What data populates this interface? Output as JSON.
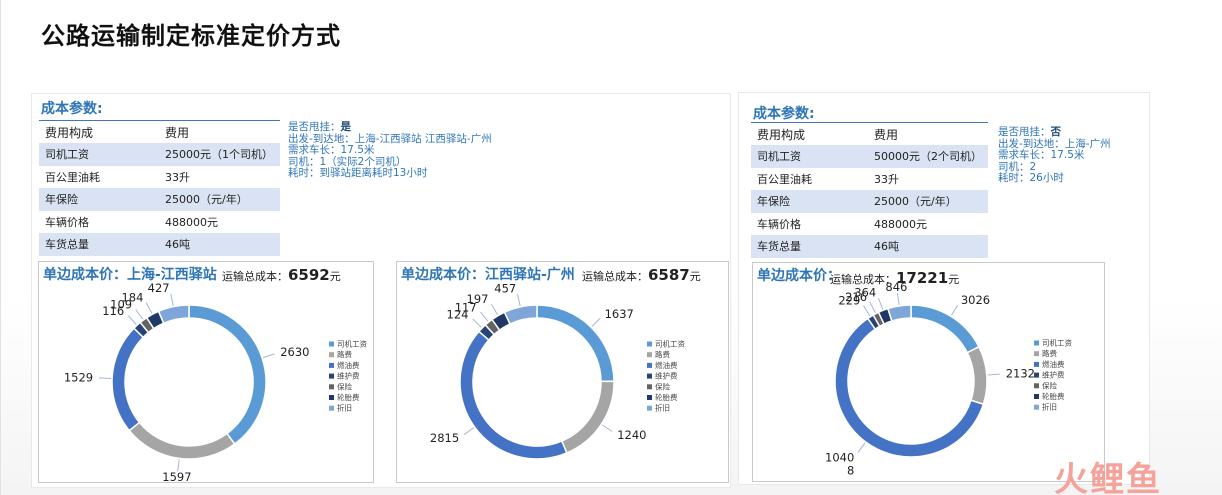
{
  "page": {
    "title": "公路运输制定标准定价方式"
  },
  "left": {
    "section_title": "成本参数:",
    "table_header": [
      "费用构成",
      "费用"
    ],
    "rows": [
      [
        "司机工资",
        "25000元（1个司机）"
      ],
      [
        "百公里油耗",
        "33升"
      ],
      [
        "年保险",
        "25000（元/年）"
      ],
      [
        "车辆价格",
        "488000元"
      ],
      [
        "车货总量",
        "46吨"
      ]
    ],
    "notes": {
      "relay_label": "是否甩挂：",
      "relay_value": "是",
      "line2": "出发-到达地：上海-江西驿站   江西驿站-广州",
      "line3": "需求车长：17.5米",
      "line4": "司机：1（实际2个司机）",
      "line5": "耗时：到驿站距离耗时13小时"
    }
  },
  "right": {
    "section_title": "成本参数:",
    "table_header": [
      "费用构成",
      "费用"
    ],
    "rows": [
      [
        "司机工资",
        "50000元（2个司机）"
      ],
      [
        "百公里油耗",
        "33升"
      ],
      [
        "年保险",
        "25000（元/年）"
      ],
      [
        "车辆价格",
        "488000元"
      ],
      [
        "车货总量",
        "46吨"
      ]
    ],
    "notes": {
      "relay_label": "是否甩挂：",
      "relay_value": "否",
      "line2": "出发-到达地：上海-广州",
      "line3": "需求车长：17.5米",
      "line4": "司机：2",
      "line5": "耗时：26小时"
    }
  },
  "chart_data": [
    {
      "type": "pie",
      "title": "单边成本价：上海-江西驿站",
      "total_label": "运输总成本：",
      "total_value": "6592",
      "total_unit": "元",
      "categories": [
        "司机工资",
        "路费",
        "燃油费",
        "维护费",
        "保险",
        "轮胎费",
        "折旧"
      ],
      "values": [
        2630,
        1597,
        1529,
        116,
        109,
        184,
        427
      ],
      "value_labels": [
        "2630",
        "1597",
        "1529",
        "116",
        "109",
        "184",
        "427"
      ],
      "legend_position": "right"
    },
    {
      "type": "pie",
      "title": "单边成本价：江西驿站-广州",
      "total_label": "运输总成本：",
      "total_value": "6587",
      "total_unit": "元",
      "categories": [
        "司机工资",
        "路费",
        "燃油费",
        "维护费",
        "保险",
        "轮胎费",
        "折旧"
      ],
      "values": [
        1637,
        1240,
        2815,
        124,
        117,
        197,
        457
      ],
      "value_labels": [
        "1637",
        "1240",
        "2815",
        "124",
        "117",
        "197",
        "457"
      ],
      "legend_position": "right"
    },
    {
      "type": "pie",
      "title": "单边成本价：",
      "total_label": "运输总成本：",
      "total_value": "17221",
      "total_unit": "元",
      "categories": [
        "司机工资",
        "路费",
        "燃油费",
        "维护费",
        "保险",
        "轮胎费",
        "折旧"
      ],
      "values": [
        3026,
        2132,
        10408,
        229,
        216,
        364,
        846
      ],
      "value_labels": [
        "3026",
        "2132",
        "1040\n8",
        "229",
        "216",
        "364",
        "846"
      ],
      "legend_position": "right"
    }
  ],
  "colors": {
    "series": [
      "#5b9bd5",
      "#a5a5a5",
      "#4472c4",
      "#264478",
      "#636363",
      "#203864",
      "#7ea6d8"
    ],
    "accent": "#2e75b6",
    "row_shade": "#dae3f3"
  },
  "watermark": "火鲤鱼"
}
